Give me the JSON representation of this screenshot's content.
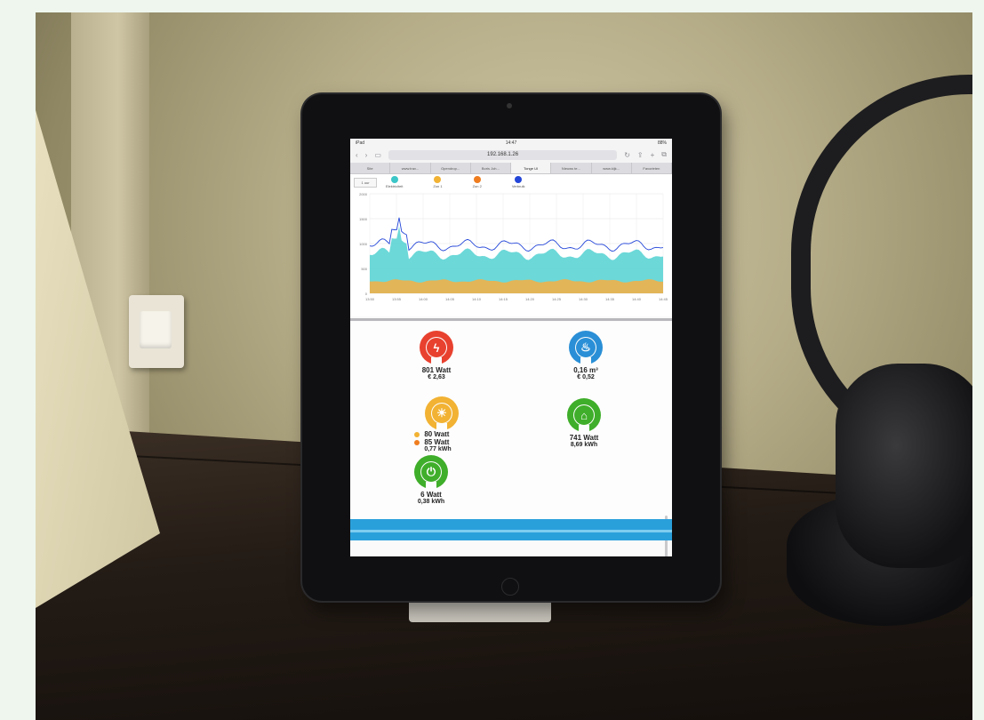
{
  "browser": {
    "status_left": "iPad",
    "status_time": "14:47",
    "status_right": "88%",
    "url": "192.168.1.26",
    "tabs": [
      "Site",
      "www.trav...",
      "Opendrop...",
      "Boris Joh...",
      "Tonge UI",
      "Nieuws te...",
      "www.kijk...",
      "Favorieten"
    ],
    "active_tab": 4
  },
  "chart": {
    "range_button": "1 uur",
    "legend": [
      {
        "name": "Elektriciteit",
        "color": "#3cc6c8"
      },
      {
        "name": "Zon 1",
        "color": "#f2b233"
      },
      {
        "name": "Zon 2",
        "color": "#ef7d1f"
      },
      {
        "name": "Verbruik",
        "color": "#2446d8"
      }
    ],
    "y_ticks": [
      "2000",
      "1500",
      "1000",
      "500",
      "0"
    ],
    "x_ticks": [
      "13:50",
      "13:55",
      "14:00",
      "14:05",
      "14:10",
      "14:15",
      "14:20",
      "14:25",
      "14:30",
      "14:35",
      "14:40",
      "14:45"
    ]
  },
  "tiles": {
    "electricity": {
      "main": "801 Watt",
      "sub": "€ 2,63",
      "color": "#e8412f",
      "icon": "lightning-icon"
    },
    "gas": {
      "main": "0,16 m³",
      "sub": "€ 0,52",
      "color": "#2a8fd6",
      "icon": "flame-icon"
    },
    "solar": {
      "line1": "80 Watt",
      "line2": "85 Watt",
      "sub": "0,77 kWh",
      "color": "#f2b233",
      "dot1": "#f2b233",
      "dot2": "#ef7d1f",
      "icon": "sun-icon"
    },
    "house": {
      "main": "741 Watt",
      "sub": "8,69 kWh",
      "color": "#3fae2a",
      "icon": "house-icon"
    },
    "car": {
      "main": "6 Watt",
      "sub": "0,38 kWh",
      "color": "#3fae2a",
      "icon": "ev-plug-icon"
    }
  }
}
